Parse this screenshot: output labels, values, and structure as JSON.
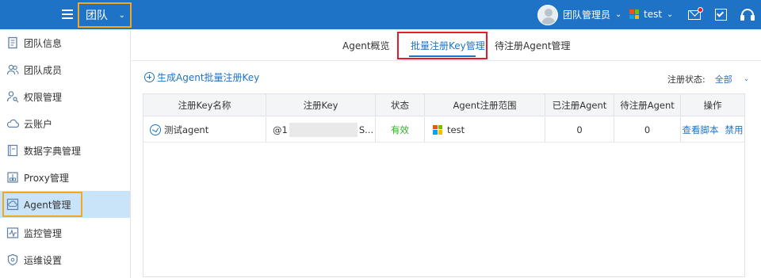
{
  "header": {
    "team_label": "团队",
    "user_name": "团队管理员",
    "tenant_name": "test",
    "icons": [
      "menu-icon",
      "chevron-down-icon",
      "avatar",
      "microsoft-logo-icon",
      "mail-icon",
      "task-check-icon",
      "headset-icon"
    ],
    "accent_color": "#1f73c6",
    "highlight_color": "#f2a920",
    "notification_color": "#e8192c"
  },
  "sidebar": {
    "items": [
      {
        "label": "团队信息",
        "icon": "document-icon"
      },
      {
        "label": "团队成员",
        "icon": "users-icon"
      },
      {
        "label": "权限管理",
        "icon": "user-key-icon"
      },
      {
        "label": "云账户",
        "icon": "cloud-icon"
      },
      {
        "label": "数据字典管理",
        "icon": "book-icon"
      },
      {
        "label": "Proxy管理",
        "icon": "proxy-icon"
      },
      {
        "label": "Agent管理",
        "icon": "agent-cloud-icon",
        "active": true
      },
      {
        "label": "监控管理",
        "icon": "monitor-icon"
      },
      {
        "label": "运维设置",
        "icon": "shield-gear-icon"
      }
    ]
  },
  "tabs": [
    {
      "label": "Agent概览"
    },
    {
      "label": "批量注册Key管理",
      "active": true
    },
    {
      "label": "待注册Agent管理"
    }
  ],
  "toolbar": {
    "generate_label": "生成Agent批量注册Key",
    "status_label": "注册状态:",
    "status_value": "全部"
  },
  "table": {
    "columns": [
      "注册Key名称",
      "注册Key",
      "状态",
      "Agent注册范围",
      "已注册Agent",
      "待注册Agent",
      "操作"
    ],
    "rows": [
      {
        "name": "测试agent",
        "key_prefix": "@1",
        "key_suffix": "S...",
        "status": "有效",
        "scope": "test",
        "registered": "0",
        "pending": "0",
        "actions": [
          "查看脚本",
          "禁用"
        ]
      }
    ]
  }
}
